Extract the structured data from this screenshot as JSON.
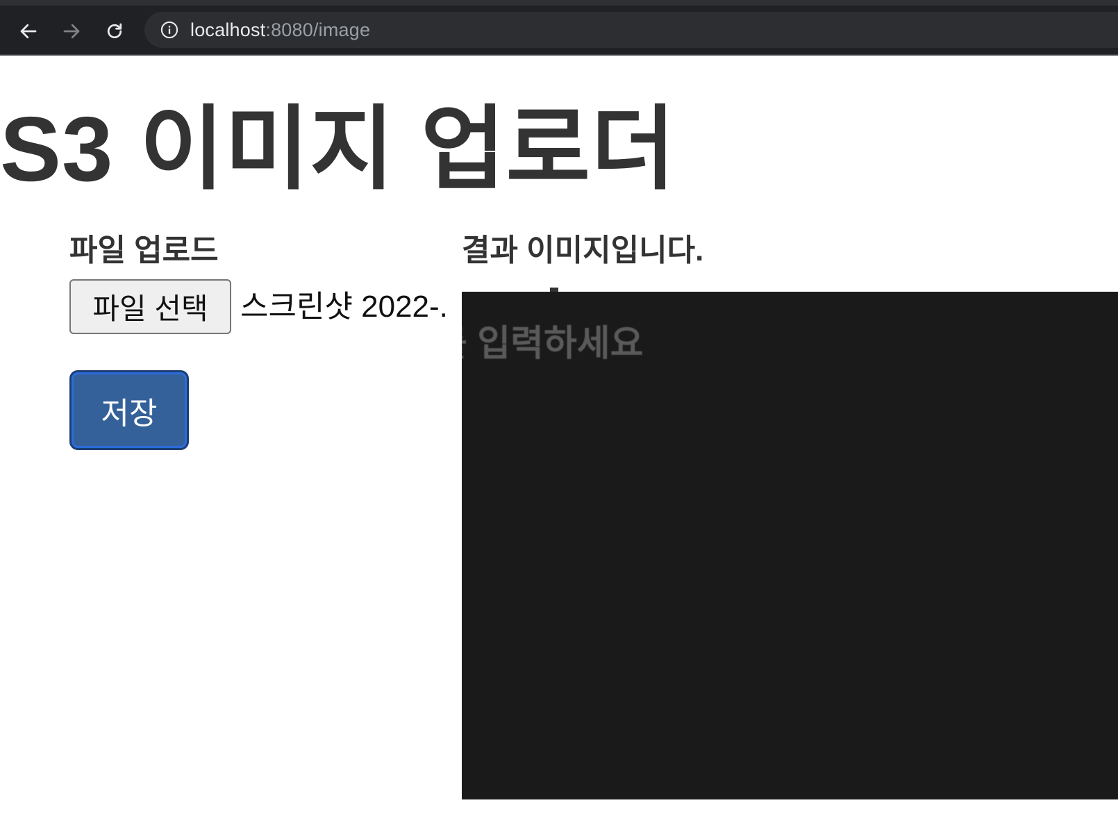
{
  "browser": {
    "url_host": "localhost",
    "url_path": ":8080/image",
    "icons": [
      "back-arrow-icon",
      "forward-arrow-icon",
      "reload-icon",
      "info-icon"
    ]
  },
  "page": {
    "title": "S3 이미지 업로더",
    "upload_section": {
      "heading": "파일 업로드",
      "file_button_label": "파일 선택",
      "file_name": "스크린샷 2022-.",
      "save_button_label": "저장"
    },
    "result_section": {
      "heading": "결과 이미지입니다.",
      "image_text": "를 입력하세요"
    }
  },
  "colors": {
    "topbar": "#202124",
    "omnibox": "#2d2e31",
    "save_button": "#34619a",
    "result_image_bg": "#1a1a1a"
  }
}
